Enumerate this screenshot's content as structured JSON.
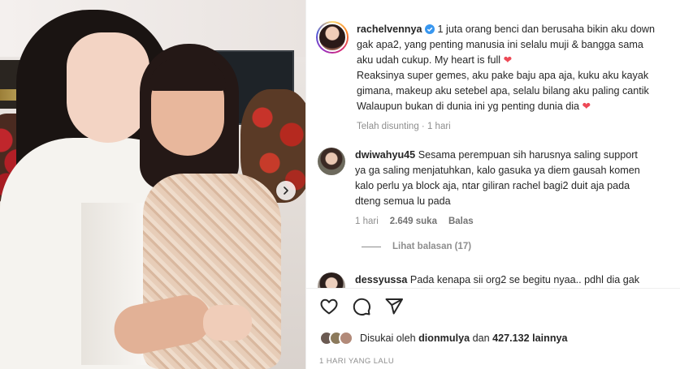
{
  "post": {
    "caption": {
      "username": "rachelvennya",
      "lines": [
        "1 juta orang benci dan berusaha bikin aku down",
        "gak apa2, yang penting manusia ini selalu muji & bangga sama",
        "aku udah cukup. My heart is full",
        "Reaksinya super gemes, aku pake baju apa aja, kuku aku kayak",
        "gimana, makeup aku setebel apa, selalu bilang aku paling cantik",
        "Walaupun bukan di dunia ini yg penting dunia dia"
      ],
      "edited_label": "Telah disunting",
      "time": "1 hari"
    },
    "comments": [
      {
        "username": "dwiwahyu45",
        "lines": [
          "Sesama perempuan sih harusnya saling support",
          "ya ga saling menjatuhkan, kalo gasuka ya diem gausah komen",
          "kalo perlu ya block aja, ntar giliran rachel bagi2 duit aja pada",
          "dteng semua lu pada"
        ],
        "time": "1 hari",
        "likes": "2.649 suka",
        "reply_label": "Balas",
        "view_replies": "Lihat balasan (17)"
      },
      {
        "username": "dessyussa",
        "text": "Pada kenapa sii org2 se begitu nyaa.. pdhl dia gak"
      }
    ],
    "liked_by_prefix": "Disukai oleh",
    "liked_by_user": "dionmulya",
    "liked_by_connector": "dan",
    "liked_by_others": "427.132 lainnya",
    "timestamp": "1 HARI YANG LALU"
  },
  "icons": {
    "carousel_next": "chevron-right-icon",
    "like": "heart-outline-icon",
    "comment": "comment-bubble-icon",
    "share": "paper-plane-icon",
    "verified": "verified-badge-icon"
  },
  "colors": {
    "heart": "#ed4956",
    "verified": "#3897f0",
    "muted_text": "#8e8e8e"
  }
}
